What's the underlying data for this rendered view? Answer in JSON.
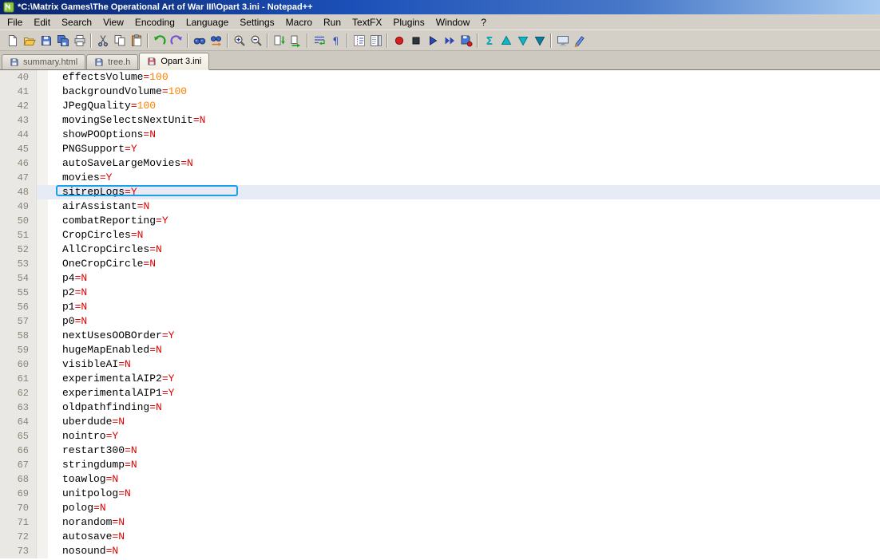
{
  "window": {
    "title": "*C:\\Matrix Games\\The Operational Art of War III\\Opart 3.ini - Notepad++",
    "app_icon": "notepadpp-icon"
  },
  "menu": {
    "items": [
      "File",
      "Edit",
      "Search",
      "View",
      "Encoding",
      "Language",
      "Settings",
      "Macro",
      "Run",
      "TextFX",
      "Plugins",
      "Window",
      "?"
    ]
  },
  "toolbar": {
    "groups": [
      [
        "new-file",
        "open",
        "save",
        "save-all",
        "print"
      ],
      [
        "cut",
        "copy",
        "paste"
      ],
      [
        "undo",
        "redo"
      ],
      [
        "find",
        "replace"
      ],
      [
        "zoom-in",
        "zoom-out"
      ],
      [
        "sync-vertical",
        "sync-horizontal"
      ],
      [
        "word-wrap",
        "show-all-characters"
      ],
      [
        "indent-guide",
        "document-map"
      ],
      [
        "record-macro",
        "stop-macro",
        "playback-macro",
        "run-macro-multiple",
        "save-macro"
      ],
      [
        "plugin-sigma",
        "plugin-triangle-up",
        "plugin-triangle-down",
        "plugin-triangle-down-dark"
      ],
      [
        "plugin-monitor",
        "spell-check"
      ]
    ]
  },
  "tabs": [
    {
      "label": "summary.html",
      "icon": "floppy-icon",
      "state": "saved",
      "active": false
    },
    {
      "label": "tree.h",
      "icon": "floppy-icon",
      "state": "saved",
      "active": false
    },
    {
      "label": "Opart 3.ini",
      "icon": "floppy-icon",
      "state": "modified",
      "active": true
    }
  ],
  "editor": {
    "first_line": 40,
    "current_line": 48,
    "lines": [
      {
        "n": 40,
        "key": "effectsVolume",
        "value": "100"
      },
      {
        "n": 41,
        "key": "backgroundVolume",
        "value": "100"
      },
      {
        "n": 42,
        "key": "JPegQuality",
        "value": "100"
      },
      {
        "n": 43,
        "key": "movingSelectsNextUnit",
        "value": "N"
      },
      {
        "n": 44,
        "key": "showPOOptions",
        "value": "N"
      },
      {
        "n": 45,
        "key": "PNGSupport",
        "value": "Y"
      },
      {
        "n": 46,
        "key": "autoSaveLargeMovies",
        "value": "N"
      },
      {
        "n": 47,
        "key": "movies",
        "value": "Y"
      },
      {
        "n": 48,
        "key": "sitrepLogs",
        "value": "Y"
      },
      {
        "n": 49,
        "key": "airAssistant",
        "value": "N"
      },
      {
        "n": 50,
        "key": "combatReporting",
        "value": "Y"
      },
      {
        "n": 51,
        "key": "CropCircles",
        "value": "N"
      },
      {
        "n": 52,
        "key": "AllCropCircles",
        "value": "N"
      },
      {
        "n": 53,
        "key": "OneCropCircle",
        "value": "N"
      },
      {
        "n": 54,
        "key": "p4",
        "value": "N"
      },
      {
        "n": 55,
        "key": "p2",
        "value": "N"
      },
      {
        "n": 56,
        "key": "p1",
        "value": "N"
      },
      {
        "n": 57,
        "key": "p0",
        "value": "N"
      },
      {
        "n": 58,
        "key": "nextUsesOOBOrder",
        "value": "Y"
      },
      {
        "n": 59,
        "key": "hugeMapEnabled",
        "value": "N"
      },
      {
        "n": 60,
        "key": "visibleAI",
        "value": "N"
      },
      {
        "n": 61,
        "key": "experimentalAIP2",
        "value": "Y"
      },
      {
        "n": 62,
        "key": "experimentalAIP1",
        "value": "Y"
      },
      {
        "n": 63,
        "key": "oldpathfinding",
        "value": "N"
      },
      {
        "n": 64,
        "key": "uberdude",
        "value": "N"
      },
      {
        "n": 65,
        "key": "nointro",
        "value": "Y"
      },
      {
        "n": 66,
        "key": "restart300",
        "value": "N"
      },
      {
        "n": 67,
        "key": "stringdump",
        "value": "N"
      },
      {
        "n": 68,
        "key": "toawlog",
        "value": "N"
      },
      {
        "n": 69,
        "key": "unitpolog",
        "value": "N"
      },
      {
        "n": 70,
        "key": "polog",
        "value": "N"
      },
      {
        "n": 71,
        "key": "norandom",
        "value": "N"
      },
      {
        "n": 72,
        "key": "autosave",
        "value": "N"
      },
      {
        "n": 73,
        "key": "nosound",
        "value": "N"
      }
    ]
  },
  "colors": {
    "title_gradient_start": "#0a246a",
    "title_gradient_end": "#a6caf0",
    "chrome": "#d4d0c8",
    "key_text": "#000000",
    "equals_sign": "#e00000",
    "value_number": "#ff8000",
    "value_flag": "#e00000",
    "current_line_bg": "#e6ebf5",
    "annotation_border": "#18a0e8",
    "line_number": "#8a8376",
    "gutter_bg": "#e9e8e4",
    "modified_tab_icon": "#d85050",
    "saved_tab_icon": "#6f84b8"
  }
}
